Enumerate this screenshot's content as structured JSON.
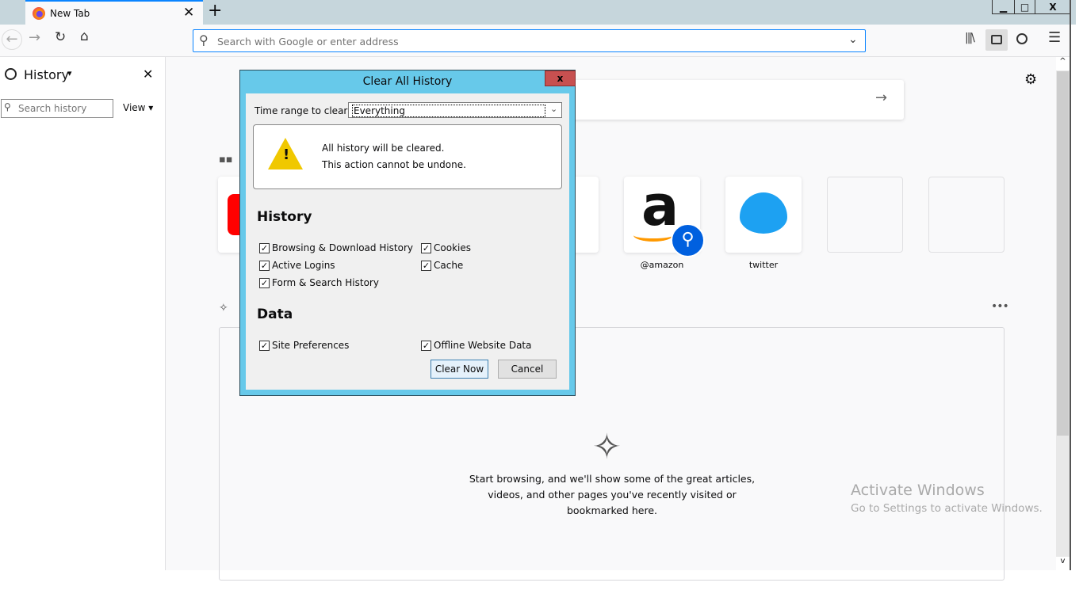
{
  "browser": {
    "tab_title": "New Tab",
    "url_placeholder": "Search with Google or enter address"
  },
  "sidebar": {
    "title": "History",
    "search_placeholder": "Search history",
    "view_label": "View"
  },
  "newtab": {
    "top_sites": [
      {
        "label": "@amazon"
      },
      {
        "label": "twitter"
      }
    ],
    "highlights_empty": [
      "Start browsing, and we'll show some of the great articles,",
      "videos, and other pages you've recently visited or",
      "bookmarked here."
    ]
  },
  "dialog": {
    "title": "Clear All History",
    "time_range_label": "Time range to clear:",
    "time_range_value": "Everything",
    "warning_line1": "All history will be cleared.",
    "warning_line2": "This action cannot be undone.",
    "history_heading": "History",
    "history_items": [
      {
        "label": "Browsing & Download History",
        "checked": true
      },
      {
        "label": "Cookies",
        "checked": true
      },
      {
        "label": "Active Logins",
        "checked": true
      },
      {
        "label": "Cache",
        "checked": true
      },
      {
        "label": "Form & Search History",
        "checked": true
      }
    ],
    "data_heading": "Data",
    "data_items": [
      {
        "label": "Site Preferences",
        "checked": true
      },
      {
        "label": "Offline Website Data",
        "checked": true
      }
    ],
    "clear_now": "Clear Now",
    "cancel": "Cancel",
    "close": "x"
  },
  "watermark": {
    "title": "Activate Windows",
    "subtitle": "Go to Settings to activate Windows."
  }
}
